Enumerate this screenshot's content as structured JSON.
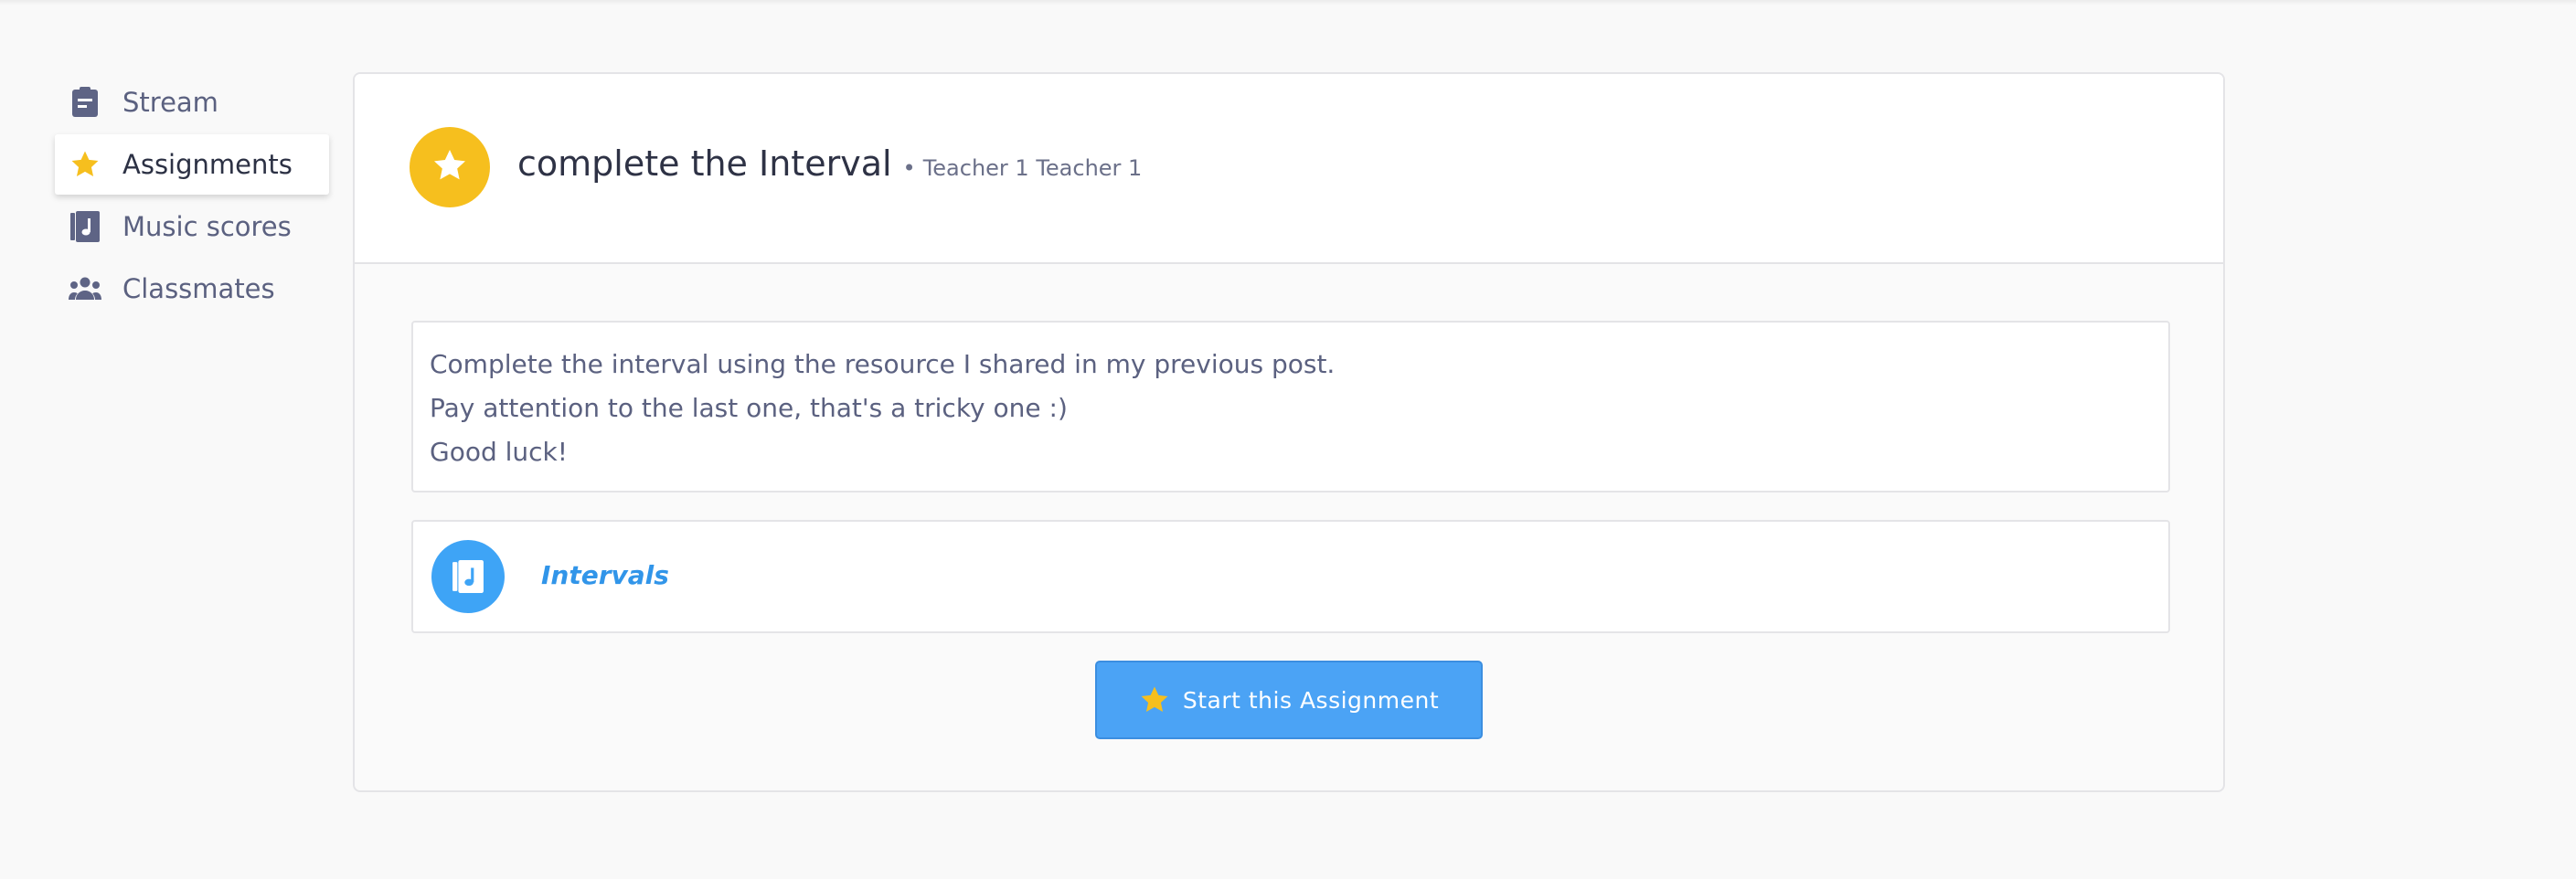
{
  "sidebar": {
    "items": [
      {
        "label": "Stream",
        "icon": "clipboard-icon",
        "active": false
      },
      {
        "label": "Assignments",
        "icon": "star-icon",
        "active": true
      },
      {
        "label": "Music scores",
        "icon": "music-book-icon",
        "active": false
      },
      {
        "label": "Classmates",
        "icon": "people-icon",
        "active": false
      }
    ]
  },
  "assignment": {
    "title": "complete the Interval",
    "separator": "•",
    "author": "Teacher 1 Teacher 1",
    "description": [
      "Complete the interval using the resource I shared in my previous post.",
      "Pay attention to the last one, that's a tricky one :)",
      "Good luck!"
    ],
    "resource": {
      "label": "Intervals",
      "icon": "music-book-icon"
    },
    "start_button": "Start this Assignment"
  },
  "colors": {
    "accent_blue": "#4ba3f5",
    "star_yellow": "#f6bf1e",
    "link_blue": "#3195e9",
    "nav_icon": "#5e6485"
  }
}
